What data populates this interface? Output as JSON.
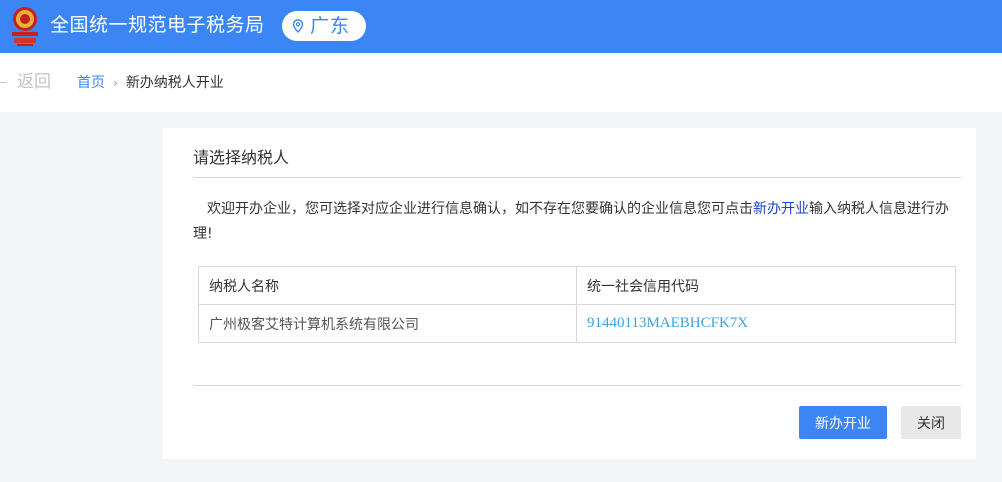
{
  "header": {
    "site_title": "全国统一规范电子税务局",
    "region": "广东",
    "brand_color": "#3c85f5"
  },
  "nav": {
    "back_label": "返回",
    "breadcrumb_home": "首页",
    "breadcrumb_separator": "›",
    "breadcrumb_current": "新办纳税人开业"
  },
  "dialog": {
    "title": "请选择纳税人",
    "intro_before": "欢迎开办企业，您可选择对应企业进行信息确认，如不存在您要确认的企业信息您可点击",
    "intro_link": "新办开业",
    "intro_after": "输入纳税人信息进行办理!",
    "table": {
      "headers": [
        "纳税人名称",
        "统一社会信用代码"
      ],
      "rows": [
        {
          "name": "广州极客艾特计算机系统有限公司",
          "code": "91440113MAEBHCFK7X"
        }
      ]
    },
    "buttons": {
      "primary": "新办开业",
      "close": "关闭"
    }
  },
  "icons": {
    "emblem": "tax-emblem-icon",
    "location": "location-pin-icon"
  }
}
